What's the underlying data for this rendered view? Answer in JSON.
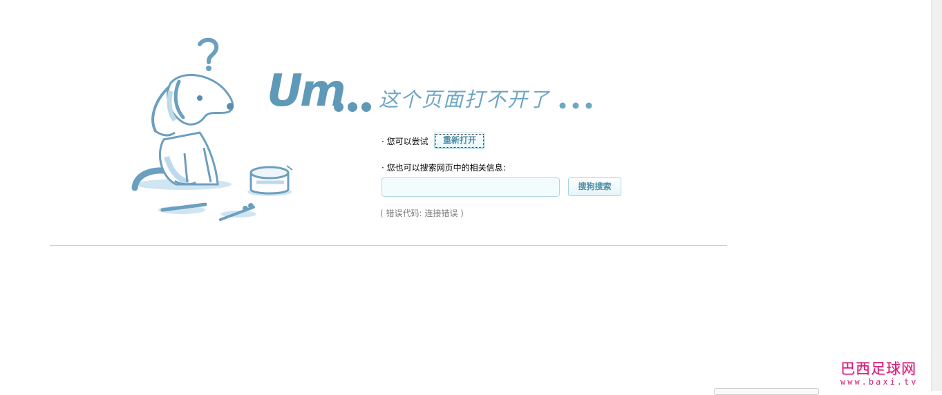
{
  "headline": {
    "um": "Um",
    "message": "这个页面打不开了"
  },
  "suggestions": {
    "retry_label": "· 您可以尝试",
    "retry_button": "重新打开",
    "search_label": "· 您也可以搜索网页中的相关信息:",
    "search_input_value": "",
    "search_button": "搜狗搜索"
  },
  "error": {
    "text": "( 错误代码: 连接错误 )"
  },
  "watermark": {
    "title": "巴西足球网",
    "url": "www.baxi.tv"
  },
  "colors": {
    "accent": "#5f99b8",
    "accent_light": "#6ea6c3",
    "watermark": "#d21e7a"
  },
  "icons": {
    "illustration": "confused-dog-icon"
  }
}
